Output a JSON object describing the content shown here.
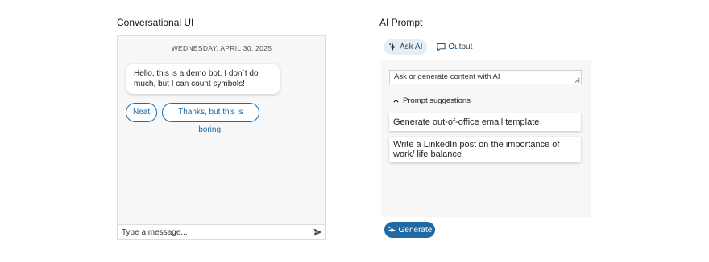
{
  "conversational": {
    "title": "Conversational UI",
    "date": "WEDNESDAY, APRIL 30, 2025",
    "bot_message": "Hello, this is a demo bot. I don`t do much, but I can count symbols!",
    "suggestions": [
      "Neat!",
      "Thanks, but this is boring."
    ],
    "input_placeholder": "Type a message...",
    "send_icon": "send-icon"
  },
  "ai_prompt": {
    "title": "AI Prompt",
    "tabs": [
      {
        "label": "Ask AI",
        "icon": "sparkle-icon",
        "active": true
      },
      {
        "label": "Output",
        "icon": "comment-icon",
        "active": false
      }
    ],
    "textarea_placeholder": "Ask or generate content with AI",
    "suggestions_toggle": "Prompt suggestions",
    "suggestions": [
      "Generate out-of-office email template",
      "Write a LinkedIn post on the importance of work/ life balance"
    ],
    "generate_label": "Generate"
  },
  "colors": {
    "accent": "#1f6aa5",
    "panel_bg": "#f7f7f7",
    "tab_active_bg": "#e6edf3"
  }
}
